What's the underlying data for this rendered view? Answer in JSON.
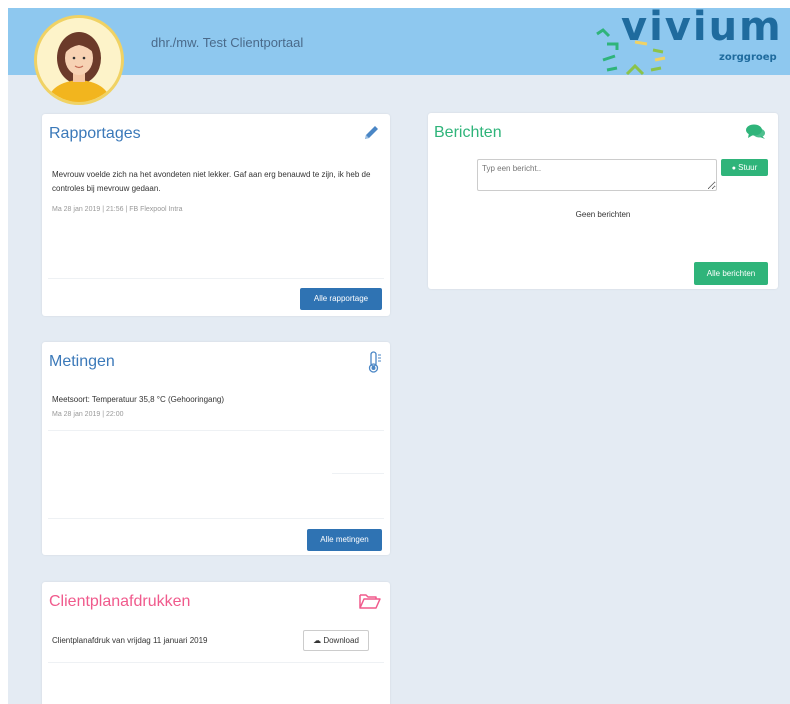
{
  "header": {
    "username": "dhr./mw. Test Clientportaal",
    "logo_word": "vivium",
    "logo_sub": "zorggroep"
  },
  "colors": {
    "header_bg": "#8ec8ef",
    "page_bg": "#e4ebf3",
    "blue_title": "#3b79b9",
    "green_title": "#2fb47a",
    "pink_title": "#f05a8c",
    "primary_button": "#2f73b3",
    "green_button": "#2fb47a"
  },
  "rapportages": {
    "title": "Rapportages",
    "icon": "pencil-icon",
    "entries": [
      {
        "text": "Mevrouw voelde zich na het avondeten niet lekker. Gaf aan erg benauwd te zijn, ik heb de controles bij mevrouw gedaan.",
        "meta": "Ma 28 jan 2019 | 21:56 | FB Flexpool Intra"
      }
    ],
    "button": "Alle rapportage"
  },
  "berichten": {
    "title": "Berichten",
    "icon": "comments-icon",
    "input_placeholder": "Typ een bericht..",
    "send_button": "Stuur",
    "empty_text": "Geen berichten",
    "all_button": "Alle berichten"
  },
  "metingen": {
    "title": "Metingen",
    "icon": "thermometer-icon",
    "entries": [
      {
        "text": "Meetsoort: Temperatuur 35,8 °C (Gehooringang)",
        "meta": "Ma 28 jan 2019 | 22:00"
      }
    ],
    "button": "Alle metingen"
  },
  "clientplan": {
    "title": "Clientplanafdrukken",
    "icon": "folder-open-icon",
    "items": [
      {
        "label": "Clientplanafdruk van vrijdag 11 januari 2019",
        "button": "Download"
      }
    ]
  }
}
